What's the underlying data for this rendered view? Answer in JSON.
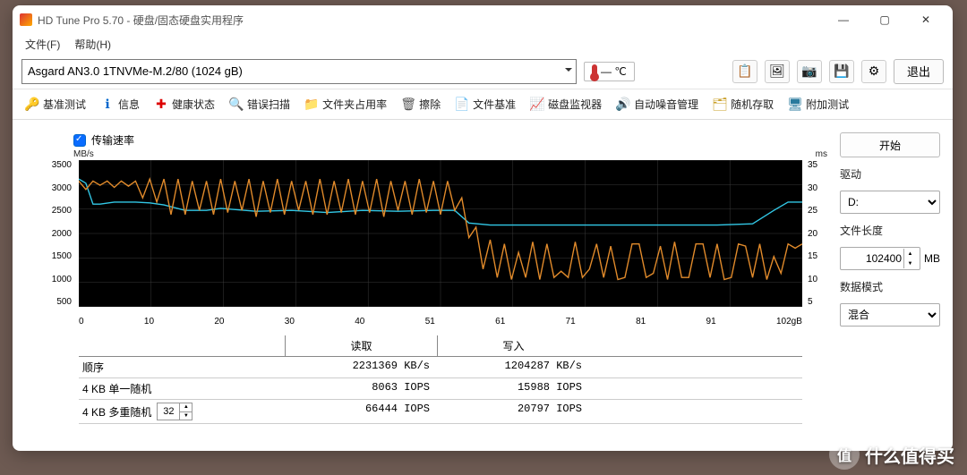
{
  "title": "HD Tune Pro 5.70  -  硬盘/固态硬盘实用程序",
  "menu": {
    "file": "文件(F)",
    "help": "帮助(H)"
  },
  "drive": "Asgard AN3.0 1TNVMe-M.2/80 (1024 gB)",
  "temp": "— ℃",
  "exit": "退出",
  "tabs": [
    {
      "icon": "🔑",
      "c": "#d9a400",
      "label": "基准测试"
    },
    {
      "icon": "ℹ",
      "c": "#0066cc",
      "label": "信息"
    },
    {
      "icon": "✚",
      "c": "#d00",
      "label": "健康状态"
    },
    {
      "icon": "🔍",
      "c": "#2a9d2a",
      "label": "错误扫描"
    },
    {
      "icon": "📁",
      "c": "#caa02a",
      "label": "文件夹占用率"
    },
    {
      "icon": "🗑",
      "c": "#555",
      "label": "擦除"
    },
    {
      "icon": "📄",
      "c": "#555",
      "label": "文件基准"
    },
    {
      "icon": "📈",
      "c": "#2a9d2a",
      "label": "磁盘监视器"
    },
    {
      "icon": "🔊",
      "c": "#caa02a",
      "label": "自动噪音管理"
    },
    {
      "icon": "🗂",
      "c": "#caa02a",
      "label": "随机存取"
    },
    {
      "icon": "🖥",
      "c": "#2a7a9d",
      "label": "附加测试"
    }
  ],
  "legend_label": "传输速率",
  "axes": {
    "ylab_l": "MB/s",
    "ylab_r": "ms",
    "yticks_l": [
      "3500",
      "3000",
      "2500",
      "2000",
      "1500",
      "1000",
      "500"
    ],
    "yticks_r": [
      "35",
      "30",
      "25",
      "20",
      "15",
      "10",
      "5"
    ],
    "xticks": [
      "0",
      "10",
      "20",
      "30",
      "40",
      "51",
      "61",
      "71",
      "81",
      "91",
      "102gB"
    ]
  },
  "table": {
    "read": "读取",
    "write": "写入",
    "rows": [
      {
        "k": "顺序",
        "r": "2231369 KB/s",
        "w": "1204287 KB/s"
      },
      {
        "k": "4 KB 单一随机",
        "r": "8063 IOPS",
        "w": "15988 IOPS"
      },
      {
        "k": "4 KB 多重随机",
        "r": "66444 IOPS",
        "w": "20797 IOPS"
      }
    ],
    "multi_spin": "32"
  },
  "side": {
    "start": "开始",
    "drive_lbl": "驱动",
    "drive_val": "D:",
    "len_lbl": "文件长度",
    "len_val": "102400",
    "len_unit": "MB",
    "mode_lbl": "数据模式",
    "mode_val": "混合"
  },
  "watermark": "什么值得买",
  "chart_data": {
    "type": "line",
    "xlabel": "gB",
    "xlim": [
      0,
      102
    ],
    "series": [
      {
        "name": "读取 (MB/s)",
        "axis": "left",
        "color": "#32c8e6",
        "ylim": [
          0,
          3500
        ],
        "points": [
          [
            0,
            3050
          ],
          [
            1,
            2950
          ],
          [
            2,
            2450
          ],
          [
            3,
            2450
          ],
          [
            5,
            2500
          ],
          [
            8,
            2500
          ],
          [
            10,
            2480
          ],
          [
            12,
            2430
          ],
          [
            15,
            2300
          ],
          [
            18,
            2300
          ],
          [
            20,
            2350
          ],
          [
            25,
            2280
          ],
          [
            30,
            2300
          ],
          [
            35,
            2250
          ],
          [
            40,
            2300
          ],
          [
            45,
            2280
          ],
          [
            50,
            2300
          ],
          [
            53,
            2300
          ],
          [
            55,
            2000
          ],
          [
            58,
            1950
          ],
          [
            60,
            1950
          ],
          [
            65,
            1950
          ],
          [
            70,
            1950
          ],
          [
            75,
            1950
          ],
          [
            80,
            1950
          ],
          [
            85,
            1950
          ],
          [
            90,
            1950
          ],
          [
            95,
            1980
          ],
          [
            98,
            2300
          ],
          [
            100,
            2500
          ],
          [
            102,
            2500
          ]
        ]
      },
      {
        "name": "写入 (MB/s)",
        "axis": "left",
        "color": "#e28b2b",
        "ylim": [
          0,
          3500
        ],
        "points": [
          [
            0,
            3000
          ],
          [
            1,
            2800
          ],
          [
            2,
            3000
          ],
          [
            3,
            2900
          ],
          [
            4,
            3000
          ],
          [
            5,
            2850
          ],
          [
            6,
            3000
          ],
          [
            7,
            2880
          ],
          [
            8,
            3000
          ],
          [
            9,
            2600
          ],
          [
            10,
            3050
          ],
          [
            11,
            2500
          ],
          [
            12,
            3050
          ],
          [
            13,
            2200
          ],
          [
            14,
            3050
          ],
          [
            15,
            2200
          ],
          [
            16,
            3000
          ],
          [
            17,
            2300
          ],
          [
            18,
            3000
          ],
          [
            19,
            2200
          ],
          [
            20,
            3050
          ],
          [
            21,
            2250
          ],
          [
            22,
            3000
          ],
          [
            23,
            2300
          ],
          [
            24,
            3050
          ],
          [
            25,
            2150
          ],
          [
            26,
            3000
          ],
          [
            27,
            2250
          ],
          [
            28,
            3050
          ],
          [
            29,
            2200
          ],
          [
            30,
            3000
          ],
          [
            31,
            2300
          ],
          [
            32,
            3000
          ],
          [
            33,
            2200
          ],
          [
            34,
            3050
          ],
          [
            35,
            2200
          ],
          [
            36,
            3000
          ],
          [
            37,
            2250
          ],
          [
            38,
            3050
          ],
          [
            39,
            2200
          ],
          [
            40,
            3000
          ],
          [
            41,
            2250
          ],
          [
            42,
            3050
          ],
          [
            43,
            2150
          ],
          [
            44,
            3000
          ],
          [
            45,
            2300
          ],
          [
            46,
            3000
          ],
          [
            47,
            2200
          ],
          [
            48,
            3050
          ],
          [
            49,
            2250
          ],
          [
            50,
            3000
          ],
          [
            51,
            2200
          ],
          [
            52,
            3000
          ],
          [
            53,
            2300
          ],
          [
            54,
            2600
          ],
          [
            55,
            1650
          ],
          [
            56,
            1900
          ],
          [
            57,
            900
          ],
          [
            58,
            1600
          ],
          [
            59,
            700
          ],
          [
            60,
            1500
          ],
          [
            61,
            650
          ],
          [
            62,
            1300
          ],
          [
            63,
            700
          ],
          [
            64,
            1550
          ],
          [
            65,
            650
          ],
          [
            66,
            1500
          ],
          [
            67,
            700
          ],
          [
            68,
            850
          ],
          [
            69,
            700
          ],
          [
            70,
            1550
          ],
          [
            71,
            700
          ],
          [
            72,
            900
          ],
          [
            73,
            1500
          ],
          [
            74,
            700
          ],
          [
            75,
            1450
          ],
          [
            76,
            650
          ],
          [
            77,
            700
          ],
          [
            78,
            1500
          ],
          [
            79,
            1500
          ],
          [
            80,
            700
          ],
          [
            81,
            800
          ],
          [
            82,
            1450
          ],
          [
            83,
            650
          ],
          [
            84,
            1550
          ],
          [
            85,
            700
          ],
          [
            86,
            700
          ],
          [
            87,
            1500
          ],
          [
            88,
            1500
          ],
          [
            89,
            700
          ],
          [
            90,
            1500
          ],
          [
            91,
            650
          ],
          [
            92,
            700
          ],
          [
            93,
            1500
          ],
          [
            94,
            1450
          ],
          [
            95,
            700
          ],
          [
            96,
            1500
          ],
          [
            97,
            650
          ],
          [
            98,
            1200
          ],
          [
            99,
            800
          ],
          [
            100,
            1500
          ],
          [
            101,
            1400
          ],
          [
            102,
            1500
          ]
        ]
      }
    ]
  }
}
